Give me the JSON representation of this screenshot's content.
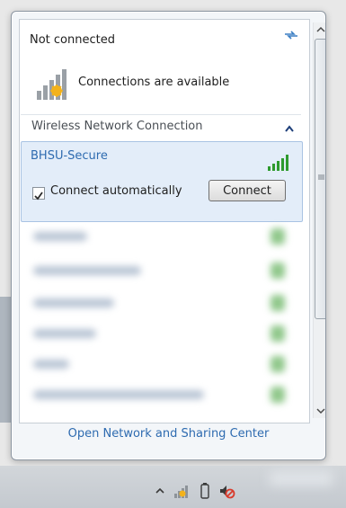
{
  "status": {
    "title": "Not connected",
    "connections_text": "Connections are available"
  },
  "section": {
    "title": "Wireless Network Connection"
  },
  "selected_network": {
    "name": "BHSU-Secure",
    "connect_automatically_label": "Connect automatically",
    "connect_automatically_checked": true,
    "connect_button_label": "Connect"
  },
  "footer": {
    "link_label": "Open Network and Sharing Center"
  },
  "icons": {
    "refresh": "refresh-icon",
    "connections": "network-warning-icon",
    "collapse": "chevron-up-icon",
    "signal": "wifi-signal-icon",
    "tray_show_hidden": "chevron-up-icon",
    "tray_network": "network-warning-icon",
    "tray_battery": "battery-icon",
    "tray_volume": "volume-muted-icon"
  },
  "colors": {
    "link": "#2e6bb0",
    "selection_bg": "#e3edf9",
    "signal_green": "#2e9a2e"
  }
}
